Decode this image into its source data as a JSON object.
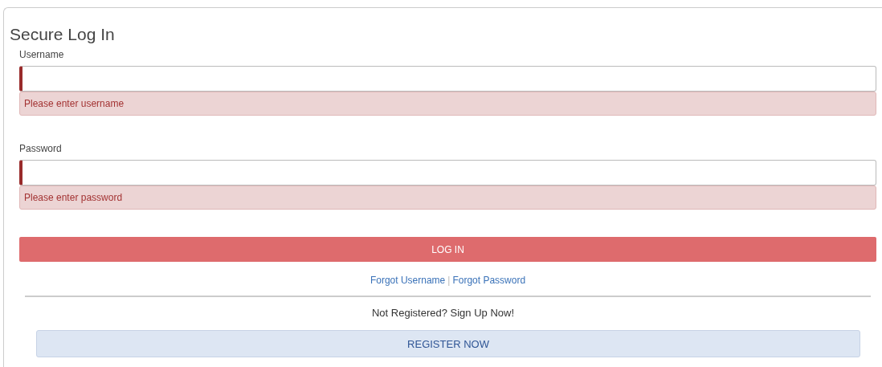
{
  "title": "Secure Log In",
  "fields": [
    {
      "label": "Username",
      "invalid": true,
      "error": "Please enter username"
    },
    {
      "label": "Password",
      "invalid": true,
      "error": "Please enter password"
    }
  ],
  "login_button": "LOG IN",
  "links": [
    "Forgot Username",
    "Forgot Password"
  ],
  "link_separator": "|",
  "signup_text": "Not Registered? Sign Up Now!",
  "register_button": "REGISTER NOW"
}
